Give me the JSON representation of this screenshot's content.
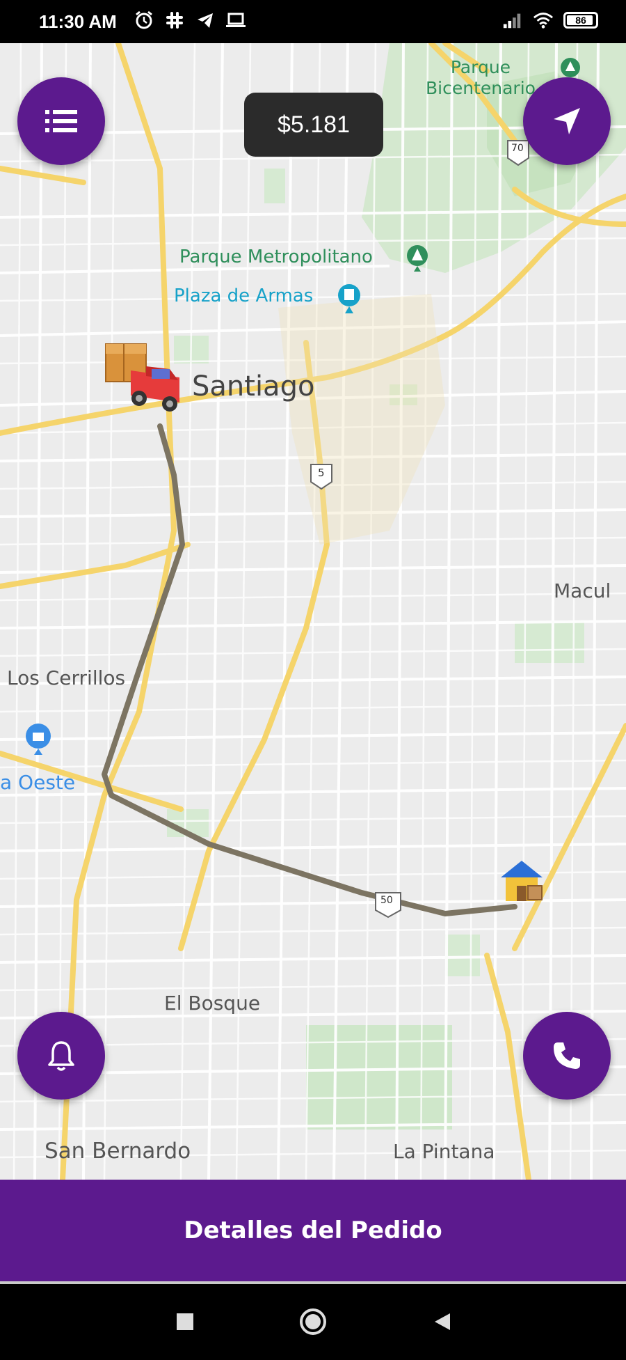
{
  "status_bar": {
    "time": "11:30 AM",
    "left_icons": [
      "alarm-icon",
      "slack-icon",
      "telegram-icon",
      "laptop-icon"
    ],
    "right_icons": [
      "signal-icon",
      "wifi-icon",
      "battery-icon"
    ],
    "battery_level": "86"
  },
  "header": {
    "price": "$5.181",
    "menu_icon": "list-icon",
    "locate_icon": "navigation-arrow-icon"
  },
  "map": {
    "places": {
      "parque_bicentenario": "Parque\nBicentenario",
      "parque_metropolitano": "Parque Metropolitano",
      "plaza_de_armas": "Plaza de Armas",
      "santiago": "Santiago",
      "macul": "Macul",
      "los_cerrillos": "Los Cerrillos",
      "plaza_oeste": "a Oeste",
      "el_bosque": "El Bosque",
      "san_bernardo": "San Bernardo",
      "la_pintana": "La Pintana"
    },
    "shields": {
      "route_70": "70",
      "route_5": "5",
      "route_50": "50"
    },
    "markers": {
      "origin": "delivery-truck-icon",
      "destination": "house-icon"
    }
  },
  "actions": {
    "notifications_icon": "bell-icon",
    "call_icon": "phone-icon",
    "order_details_label": "Detalles del Pedido"
  },
  "nav_bar": {
    "buttons": [
      "recents-square-icon",
      "home-circle-icon",
      "back-triangle-icon"
    ]
  },
  "colors": {
    "accent": "#5c1a8e",
    "map_background": "#e9e9e9",
    "road_major": "#f5d46b",
    "route": "#7c7462",
    "park_label": "#2f8f5b"
  }
}
